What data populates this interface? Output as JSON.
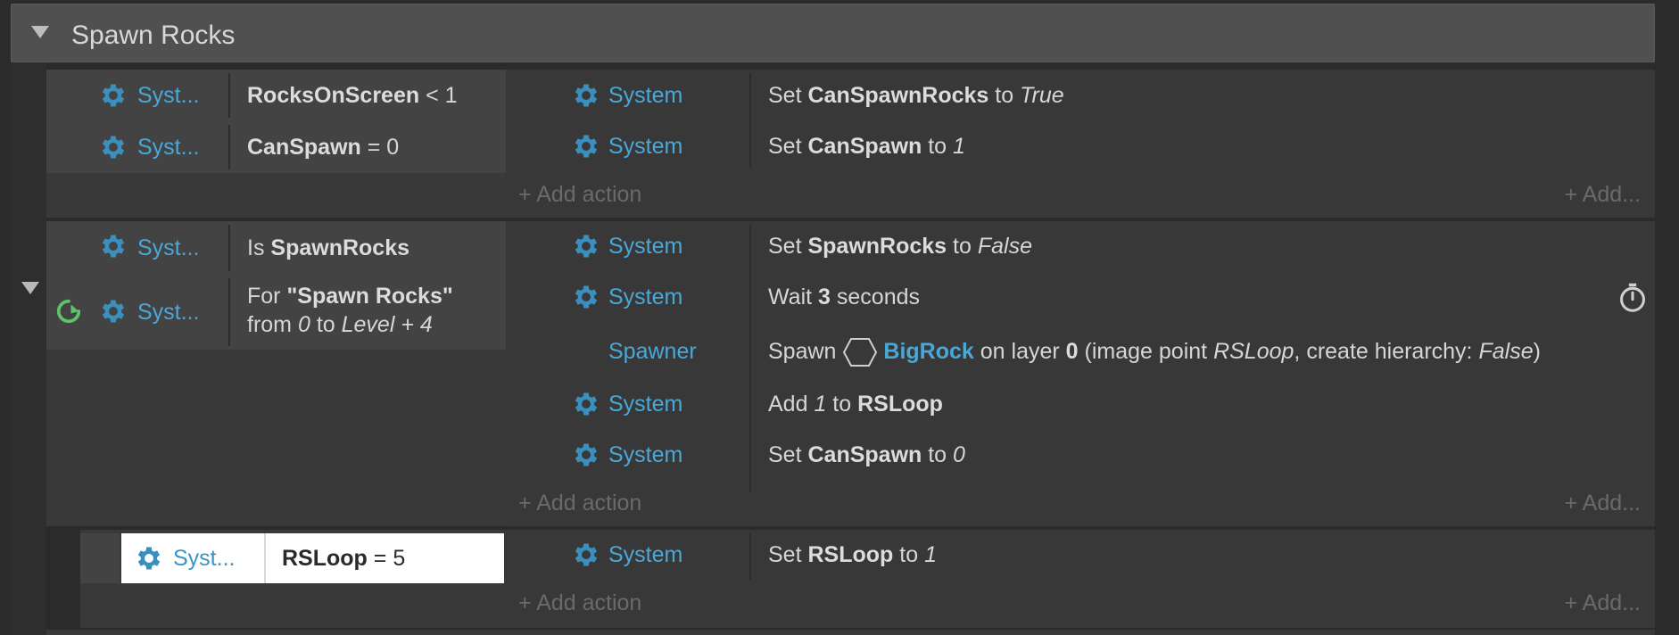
{
  "group": {
    "title": "Spawn Rocks"
  },
  "event1": {
    "conditions": [
      {
        "object": "Syst...",
        "var": "RocksOnScreen",
        "op": "< 1"
      },
      {
        "object": "Syst...",
        "var": "CanSpawn",
        "op": "= 0"
      }
    ],
    "actions": [
      {
        "object": "System",
        "prefix": "Set",
        "var": "CanSpawnRocks",
        "mid": "to",
        "value": "True"
      },
      {
        "object": "System",
        "prefix": "Set",
        "var": "CanSpawn",
        "mid": "to",
        "value": "1"
      }
    ],
    "add_action": "Add action",
    "add_more": "Add..."
  },
  "event2": {
    "conditions": [
      {
        "object": "Syst...",
        "prefix": "Is",
        "var": "SpawnRocks"
      },
      {
        "object": "Syst...",
        "line1_prefix": "For",
        "line1_name": "\"Spawn Rocks\"",
        "line2_from": "from",
        "line2_start": "0",
        "line2_to": "to",
        "line2_end": "Level + 4"
      }
    ],
    "actions": [
      {
        "object": "System",
        "prefix": "Set",
        "var": "SpawnRocks",
        "mid": "to",
        "value": "False"
      },
      {
        "object": "System",
        "prefix": "Wait",
        "num": "3",
        "suffix": "seconds"
      },
      {
        "object": "Spawner",
        "prefix": "Spawn",
        "target": "BigRock",
        "mid": "on layer",
        "layer": "0",
        "p1": "(image point",
        "point": "RSLoop",
        "p2": ", create hierarchy:",
        "hier": "False",
        "p3": ")"
      },
      {
        "object": "System",
        "prefix": "Add",
        "value": "1",
        "mid": "to",
        "var": "RSLoop"
      },
      {
        "object": "System",
        "prefix": "Set",
        "var": "CanSpawn",
        "mid": "to",
        "value": "0"
      }
    ],
    "add_action": "Add action",
    "add_more": "Add..."
  },
  "event3": {
    "conditions": [
      {
        "object": "Syst...",
        "var": "RSLoop",
        "op": "= 5"
      }
    ],
    "actions": [
      {
        "object": "System",
        "prefix": "Set",
        "var": "RSLoop",
        "mid": "to",
        "value": "1"
      }
    ],
    "add_action": "Add action",
    "add_more": "Add..."
  },
  "colors": {
    "object_blue": "#4aa8d8",
    "loop_green": "#5ec46a",
    "gear_blue": "#3b8fbf"
  },
  "icons": [
    "gear-icon",
    "loop-icon",
    "timer-icon",
    "sprite-icon",
    "plus-icon",
    "collapse-arrow-icon"
  ]
}
